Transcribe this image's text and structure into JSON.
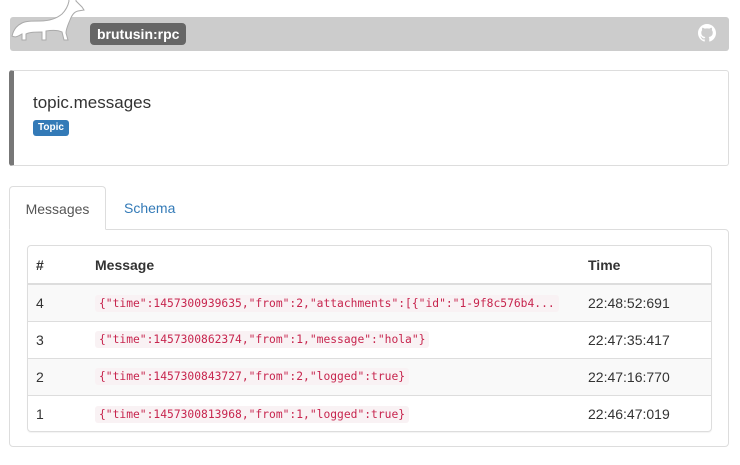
{
  "header": {
    "brand": "brutusin:rpc",
    "logo_icon": "dog-silhouette-icon",
    "github_icon": "github-icon"
  },
  "topic": {
    "title": "topic.messages",
    "badge": "Topic"
  },
  "tabs": [
    {
      "label": "Messages",
      "active": true
    },
    {
      "label": "Schema",
      "active": false
    }
  ],
  "table": {
    "headers": [
      "#",
      "Message",
      "Time"
    ],
    "rows": [
      {
        "num": "4",
        "message": "{\"time\":1457300939635,\"from\":2,\"attachments\":[{\"id\":\"1-9f8c576b4...",
        "time": "22:48:52:691"
      },
      {
        "num": "3",
        "message": "{\"time\":1457300862374,\"from\":1,\"message\":\"hola\"}",
        "time": "22:47:35:417"
      },
      {
        "num": "2",
        "message": "{\"time\":1457300843727,\"from\":2,\"logged\":true}",
        "time": "22:47:16:770"
      },
      {
        "num": "1",
        "message": "{\"time\":1457300813968,\"from\":1,\"logged\":true}",
        "time": "22:46:47:019"
      }
    ]
  },
  "colors": {
    "navbar": "#cccccc",
    "brand_bg": "#666666",
    "badge": "#337ab7",
    "code_text": "#c7254e",
    "code_bg": "#f9f2f4"
  }
}
